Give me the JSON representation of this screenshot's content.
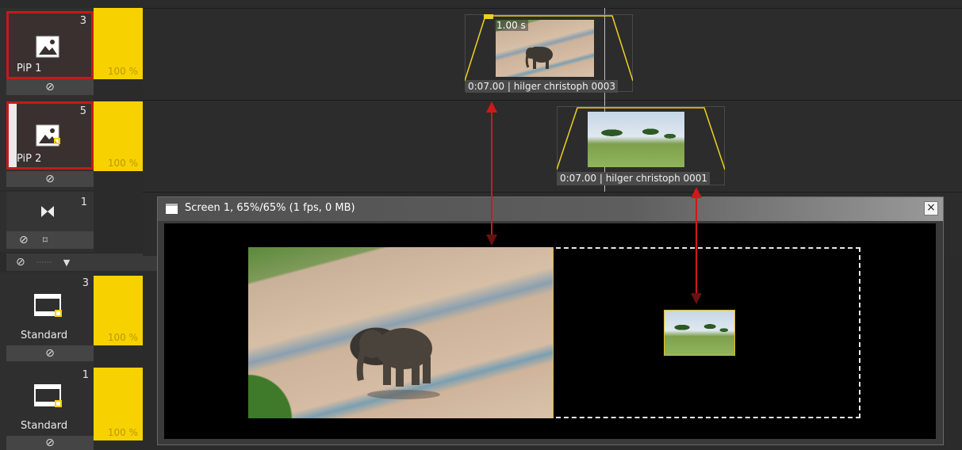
{
  "tracks": [
    {
      "number": "3",
      "label": "PiP 1",
      "opacity": "100 %",
      "selected": true,
      "icon": "image-icon"
    },
    {
      "number": "5",
      "label": "PiP 2",
      "opacity": "100 %",
      "selected": true,
      "icon": "image-link-icon"
    },
    {
      "number": "1",
      "label": "",
      "opacity": "",
      "selected": false,
      "icon": "bowtie-transition-icon"
    },
    {
      "number": "3",
      "label": "Standard",
      "opacity": "100 %",
      "selected": false,
      "icon": "film-icon"
    },
    {
      "number": "1",
      "label": "Standard",
      "opacity": "100 %",
      "selected": false,
      "icon": "film-icon"
    }
  ],
  "clips": [
    {
      "duration_label": "1.00 s",
      "caption": "0:07.00 | hilger christoph 0003",
      "image": "elephant"
    },
    {
      "caption": "0:07.00 | hilger christoph 0001",
      "image": "acacia-trees"
    }
  ],
  "screen_window": {
    "title": "Screen 1, 65%/65% (1 fps, 0 MB)",
    "close_label": "×"
  },
  "colors": {
    "selection_border": "#c41a1a",
    "opacity_bar": "#f7d200",
    "arrow": "#d01818"
  }
}
